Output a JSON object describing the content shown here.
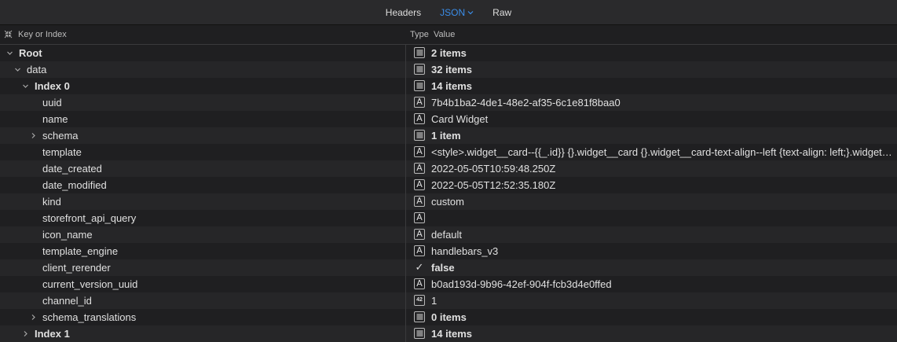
{
  "tabs": [
    {
      "label": "Headers"
    },
    {
      "label": "JSON"
    },
    {
      "label": "Raw"
    }
  ],
  "columns": {
    "key": "Key or Index",
    "type": "Type",
    "value": "Value"
  },
  "rows": [
    {
      "key": "Root",
      "type": "list-icon",
      "value": "2 items"
    },
    {
      "key": "data",
      "type": "list-icon",
      "value": "32 items"
    },
    {
      "key": "Index 0",
      "type": "list-icon",
      "value": "14 items"
    },
    {
      "key": "uuid",
      "type": "string-icon",
      "value": "7b4b1ba2-4de1-48e2-af35-6c1e81f8baa0"
    },
    {
      "key": "name",
      "type": "string-icon",
      "value": "Card Widget"
    },
    {
      "key": "schema",
      "type": "list-icon",
      "value": "1 item"
    },
    {
      "key": "template",
      "type": "string-icon",
      "value": "<style>.widget__card--{{_.id}} {}.widget__card {}.widget__card-text-align--left {text-align: left;}.widget__card-text-align--center {text-align: center;}"
    },
    {
      "key": "date_created",
      "type": "string-icon",
      "value": "2022-05-05T10:59:48.250Z"
    },
    {
      "key": "date_modified",
      "type": "string-icon",
      "value": "2022-05-05T12:52:35.180Z"
    },
    {
      "key": "kind",
      "type": "string-icon",
      "value": "custom"
    },
    {
      "key": "storefront_api_query",
      "type": "string-icon",
      "value": ""
    },
    {
      "key": "icon_name",
      "type": "string-icon",
      "value": "default"
    },
    {
      "key": "template_engine",
      "type": "string-icon",
      "value": "handlebars_v3"
    },
    {
      "key": "client_rerender",
      "type": "checkmark-icon",
      "value": "false"
    },
    {
      "key": "current_version_uuid",
      "type": "string-icon",
      "value": "b0ad193d-9b96-42ef-904f-fcb3d4e0ffed"
    },
    {
      "key": "channel_id",
      "type": "number-icon",
      "value": "1"
    },
    {
      "key": "schema_translations",
      "type": "list-icon",
      "value": "0 items"
    },
    {
      "key": "Index 1",
      "type": "list-icon",
      "value": "14 items"
    }
  ],
  "icon_labels": {
    "string": "A",
    "number": "42",
    "check": "✓"
  }
}
